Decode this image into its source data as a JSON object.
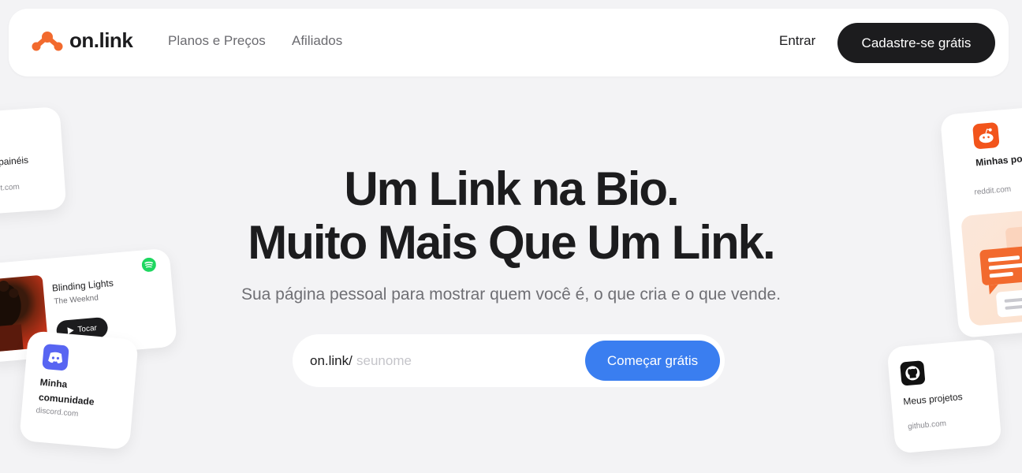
{
  "brand": {
    "name": "on.link",
    "accent_color": "#f26a2e"
  },
  "nav": {
    "links": [
      {
        "label": "Planos e Preços"
      },
      {
        "label": "Afiliados"
      }
    ],
    "login_label": "Entrar",
    "signup_label": "Cadastre-se grátis"
  },
  "hero": {
    "headline_line1": "Um Link na Bio.",
    "headline_line2": "Muito Mais Que Um Link.",
    "subtitle": "Sua página pessoal para mostrar quem você é, o que cria e o que vende."
  },
  "signup_form": {
    "prefix": "on.link/",
    "placeholder": "seunome",
    "value": "",
    "button_label": "Começar grátis",
    "button_color": "#3a7ef0"
  },
  "cards": {
    "paineis": {
      "title": "painéis",
      "domain": "t.com"
    },
    "spotify": {
      "song": "Blinding Lights",
      "artist": "The Weeknd",
      "play_label": "Tocar",
      "icon": "spotify-icon"
    },
    "discord": {
      "title": "Minha comunidade",
      "domain": "discord.com",
      "icon": "discord-icon"
    },
    "reddit": {
      "title": "Minhas po",
      "domain": "reddit.com",
      "icon": "reddit-icon"
    },
    "github": {
      "title": "Meus projetos",
      "domain": "github.com",
      "icon": "github-icon"
    }
  }
}
